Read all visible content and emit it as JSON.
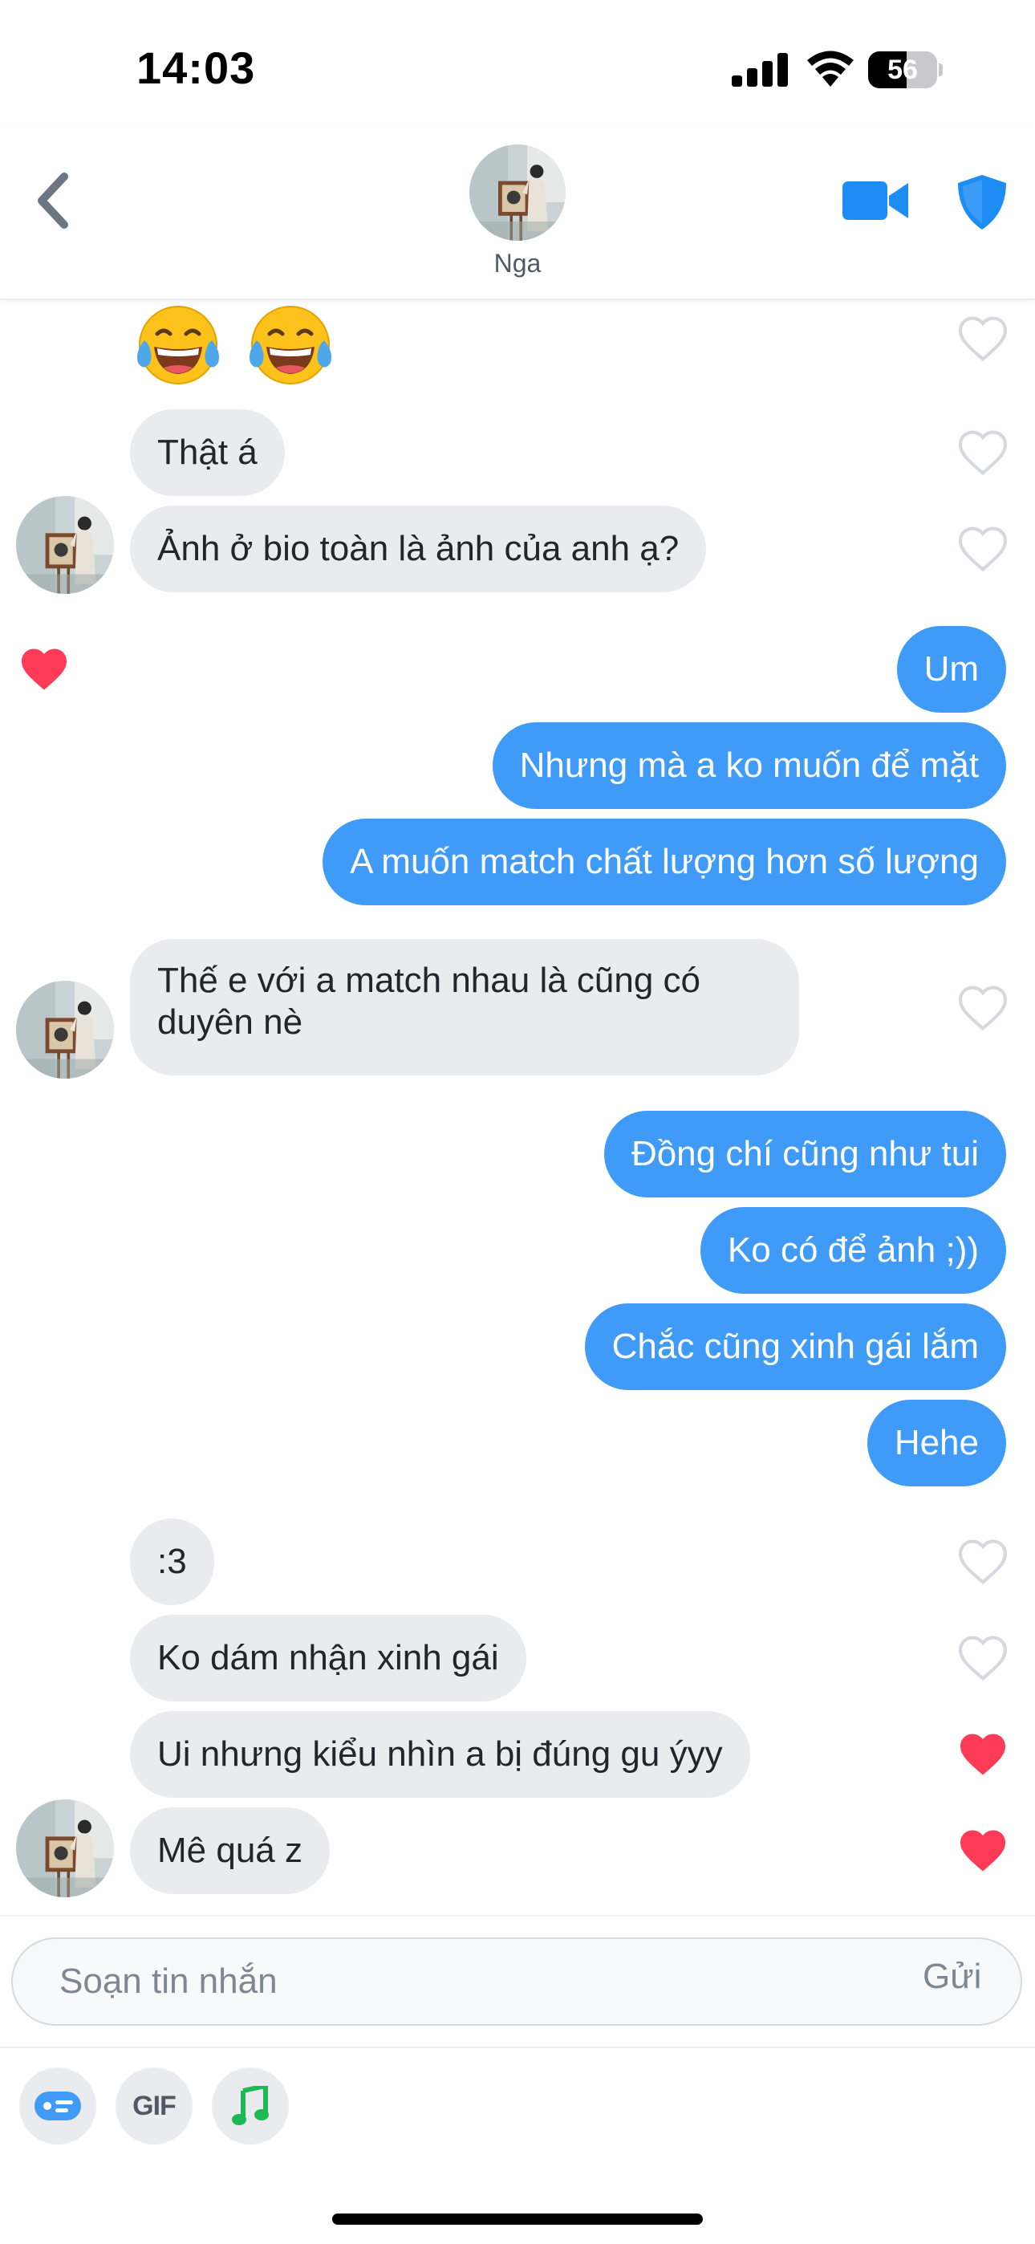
{
  "status_bar": {
    "time": "14:03",
    "battery_percent": "56",
    "battery_level": 0.56
  },
  "header": {
    "contact_name": "Nga",
    "icons": {
      "back": "chevron-left-icon",
      "video": "video-camera-icon",
      "safety": "shield-icon"
    }
  },
  "messages": {
    "m1": "Thật á",
    "m2": "Ảnh ở bio toàn là ảnh của anh ạ?",
    "m3": "Um",
    "m4": "Nhưng mà a ko muốn để mặt",
    "m5": "A muốn match chất lượng hơn số lượng",
    "m6": "Thế e với a match nhau là cũng có duyên nè",
    "m7": "Đồng chí cũng như tui",
    "m8": "Ko có để ảnh ;))",
    "m9": "Chắc cũng xinh gái lắm",
    "m10": "Hehe",
    "m11": ":3",
    "m12": "Ko dám nhận xinh gái",
    "m13": "Ui nhưng kiểu nhìn a bị đúng gu ýyy",
    "m14": "Mê quá z"
  },
  "composer": {
    "placeholder": "Soạn tin nhắn",
    "send_label": "Gửi",
    "tools": {
      "gif": "GIF",
      "sticker_icon": "sticker-icon",
      "music_icon": "music-note-icon"
    }
  },
  "colors": {
    "outgoing": "#3f9bf7",
    "incoming": "#e9ebee",
    "heart_liked": "#fd3b57",
    "heart_empty": "#d5d9de",
    "accent": "#1d8df5"
  }
}
